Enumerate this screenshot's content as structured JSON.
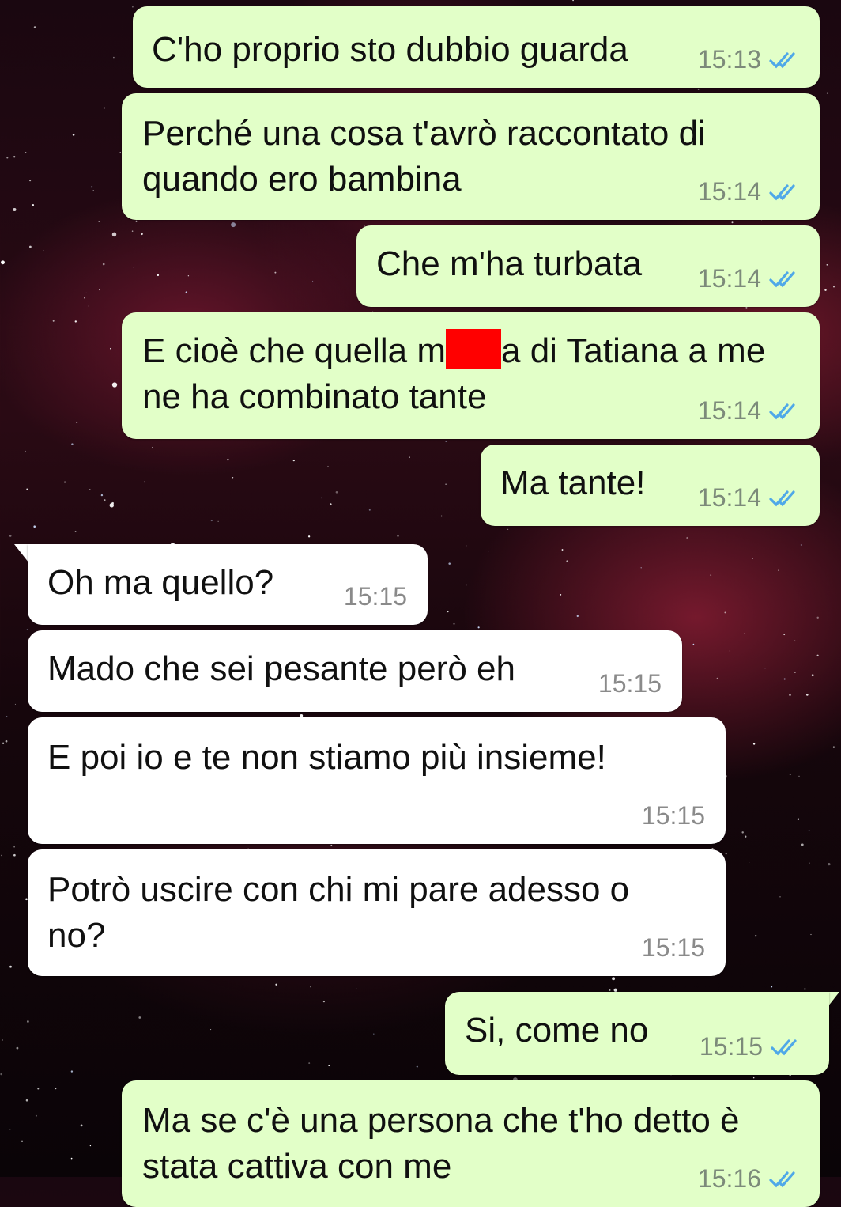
{
  "colors": {
    "outgoing_bubble": "#e2ffc8",
    "incoming_bubble": "#ffffff",
    "read_ticks": "#4fa8e8",
    "redaction": "#ff0000"
  },
  "messages": [
    {
      "text": "C'ho proprio sto dubbio guarda",
      "time": "15:13",
      "direction": "outgoing",
      "status": "read"
    },
    {
      "text": "Perché una cosa t'avrò raccontato di quando ero bambina",
      "time": "15:14",
      "direction": "outgoing",
      "status": "read"
    },
    {
      "text": "Che m'ha turbata",
      "time": "15:14",
      "direction": "outgoing",
      "status": "read"
    },
    {
      "text_before": "E cioè che quella m",
      "text_after": "a di Tatiana a me ne ha combinato tante",
      "redacted": true,
      "time": "15:14",
      "direction": "outgoing",
      "status": "read"
    },
    {
      "text": "Ma tante!",
      "time": "15:14",
      "direction": "outgoing",
      "status": "read"
    },
    {
      "text": "Oh ma quello?",
      "time": "15:15",
      "direction": "incoming"
    },
    {
      "text": "Mado che sei pesante però eh",
      "time": "15:15",
      "direction": "incoming"
    },
    {
      "text": "E poi io e te non stiamo più insieme!",
      "time": "15:15",
      "direction": "incoming"
    },
    {
      "text": "Potrò uscire con chi mi pare adesso o no?",
      "time": "15:15",
      "direction": "incoming"
    },
    {
      "text": "Si, come no",
      "time": "15:15",
      "direction": "outgoing",
      "status": "read"
    },
    {
      "text": "Ma se c'è una persona che t'ho detto è stata cattiva con me",
      "time": "15:16",
      "direction": "outgoing",
      "status": "read"
    }
  ]
}
